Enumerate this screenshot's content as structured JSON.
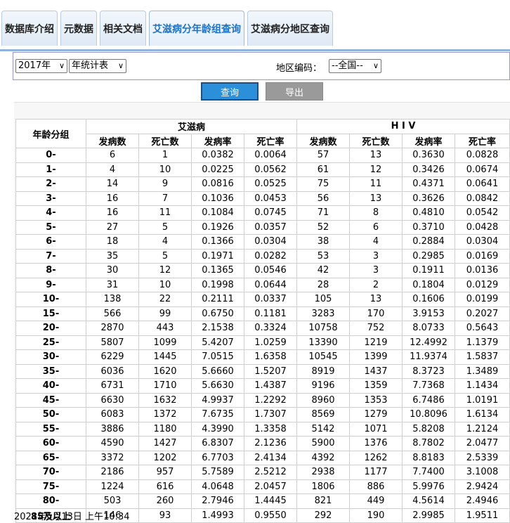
{
  "tabs": [
    {
      "label": "数据库介绍"
    },
    {
      "label": "元数据"
    },
    {
      "label": "相关文档"
    },
    {
      "label": "艾滋病分年龄组查询"
    },
    {
      "label": "艾滋病分地区查询"
    }
  ],
  "filter": {
    "year": "2017年",
    "report_type": "年统计表",
    "region_label": "地区编码：",
    "region_value": "--全国--"
  },
  "buttons": {
    "query": "查询",
    "export": "导出"
  },
  "table": {
    "age_group_header": "年龄分组",
    "group_aids": "艾滋病",
    "group_hiv": "H I V",
    "columns": [
      "发病数",
      "死亡数",
      "发病率",
      "死亡率",
      "发病数",
      "死亡数",
      "发病率",
      "死亡率"
    ],
    "rows": [
      [
        "0-",
        "6",
        "1",
        "0.0382",
        "0.0064",
        "57",
        "13",
        "0.3630",
        "0.0828"
      ],
      [
        "1-",
        "4",
        "10",
        "0.0225",
        "0.0562",
        "61",
        "12",
        "0.3426",
        "0.0674"
      ],
      [
        "2-",
        "14",
        "9",
        "0.0816",
        "0.0525",
        "75",
        "11",
        "0.4371",
        "0.0641"
      ],
      [
        "3-",
        "16",
        "7",
        "0.1036",
        "0.0453",
        "56",
        "13",
        "0.3626",
        "0.0842"
      ],
      [
        "4-",
        "16",
        "11",
        "0.1084",
        "0.0745",
        "71",
        "8",
        "0.4810",
        "0.0542"
      ],
      [
        "5-",
        "27",
        "5",
        "0.1926",
        "0.0357",
        "52",
        "6",
        "0.3710",
        "0.0428"
      ],
      [
        "6-",
        "18",
        "4",
        "0.1366",
        "0.0304",
        "38",
        "4",
        "0.2884",
        "0.0304"
      ],
      [
        "7-",
        "35",
        "5",
        "0.1971",
        "0.0282",
        "53",
        "3",
        "0.2985",
        "0.0169"
      ],
      [
        "8-",
        "30",
        "12",
        "0.1365",
        "0.0546",
        "42",
        "3",
        "0.1911",
        "0.0136"
      ],
      [
        "9-",
        "31",
        "10",
        "0.1998",
        "0.0644",
        "28",
        "2",
        "0.1804",
        "0.0129"
      ],
      [
        "10-",
        "138",
        "22",
        "0.2111",
        "0.0337",
        "105",
        "13",
        "0.1606",
        "0.0199"
      ],
      [
        "15-",
        "566",
        "99",
        "0.6750",
        "0.1181",
        "3283",
        "170",
        "3.9153",
        "0.2027"
      ],
      [
        "20-",
        "2870",
        "443",
        "2.1538",
        "0.3324",
        "10758",
        "752",
        "8.0733",
        "0.5643"
      ],
      [
        "25-",
        "5807",
        "1099",
        "5.4207",
        "1.0259",
        "13390",
        "1219",
        "12.4992",
        "1.1379"
      ],
      [
        "30-",
        "6229",
        "1445",
        "7.0515",
        "1.6358",
        "10545",
        "1399",
        "11.9374",
        "1.5837"
      ],
      [
        "35-",
        "6036",
        "1620",
        "5.6660",
        "1.5207",
        "8919",
        "1437",
        "8.3723",
        "1.3489"
      ],
      [
        "40-",
        "6731",
        "1710",
        "5.6630",
        "1.4387",
        "9196",
        "1359",
        "7.7368",
        "1.1434"
      ],
      [
        "45-",
        "6630",
        "1632",
        "4.9937",
        "1.2292",
        "8960",
        "1353",
        "6.7486",
        "1.0191"
      ],
      [
        "50-",
        "6083",
        "1372",
        "7.6735",
        "1.7307",
        "8569",
        "1279",
        "10.8096",
        "1.6134"
      ],
      [
        "55-",
        "3886",
        "1180",
        "4.3990",
        "1.3358",
        "5142",
        "1071",
        "5.8208",
        "1.2124"
      ],
      [
        "60-",
        "4590",
        "1427",
        "6.8307",
        "2.1236",
        "5900",
        "1376",
        "8.7802",
        "2.0477"
      ],
      [
        "65-",
        "3372",
        "1202",
        "6.7703",
        "2.4134",
        "4392",
        "1262",
        "8.8183",
        "2.5339"
      ],
      [
        "70-",
        "2186",
        "957",
        "5.7589",
        "2.5212",
        "2938",
        "1177",
        "7.7400",
        "3.1008"
      ],
      [
        "75-",
        "1224",
        "616",
        "4.0648",
        "2.0457",
        "1806",
        "886",
        "5.9976",
        "2.9424"
      ],
      [
        "80-",
        "503",
        "260",
        "2.7946",
        "1.4445",
        "821",
        "449",
        "4.5614",
        "2.4946"
      ],
      [
        "85及以上",
        "146",
        "93",
        "1.4993",
        "0.9550",
        "292",
        "190",
        "2.9985",
        "1.9511"
      ]
    ]
  },
  "timestamp": "2021年5月13日 上午10:34"
}
